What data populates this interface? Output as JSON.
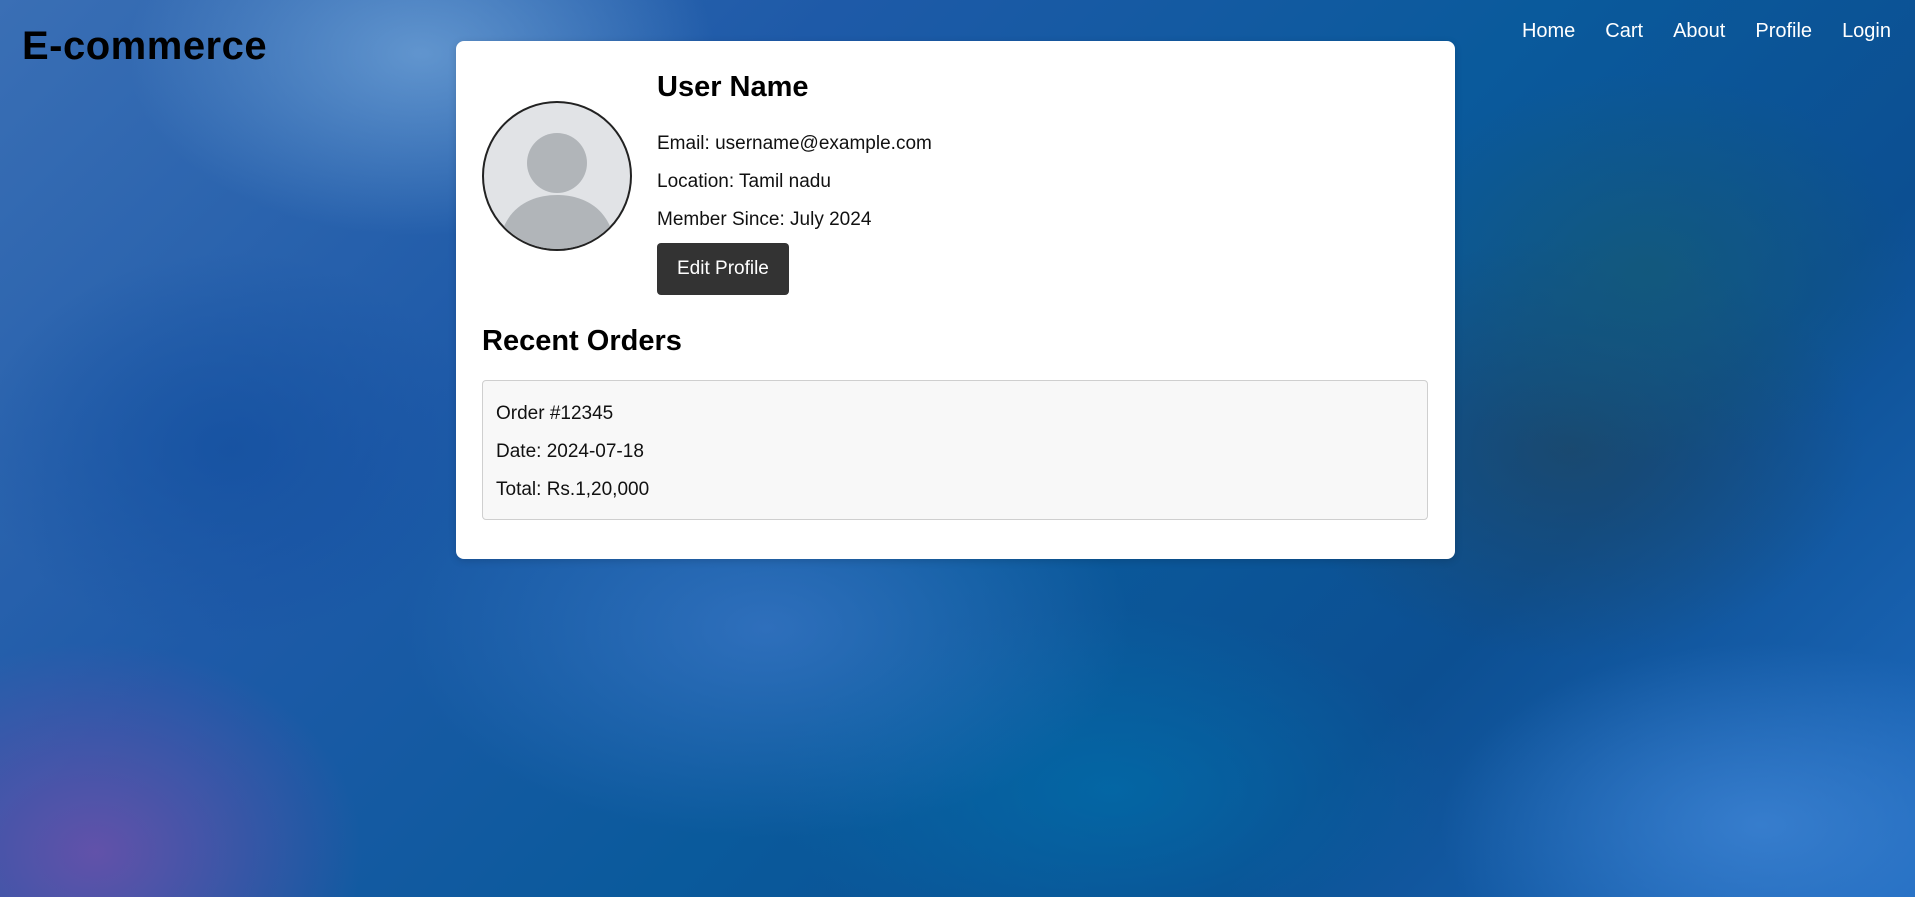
{
  "brand": "E-commerce",
  "nav": [
    {
      "label": "Home",
      "name": "nav-home"
    },
    {
      "label": "Cart",
      "name": "nav-cart"
    },
    {
      "label": "About",
      "name": "nav-about"
    },
    {
      "label": "Profile",
      "name": "nav-profile"
    },
    {
      "label": "Login",
      "name": "nav-login"
    }
  ],
  "profile": {
    "avatar_icon": "user-avatar-placeholder-icon",
    "name": "User Name",
    "email": "Email: username@example.com",
    "location": "Location: Tamil nadu",
    "member_since": "Member Since: July 2024",
    "edit_label": "Edit Profile"
  },
  "orders": {
    "title": "Recent Orders",
    "items": [
      {
        "number": "Order #12345",
        "date": "Date: 2024-07-18",
        "total": "Total: Rs.1,20,000"
      }
    ]
  },
  "colors": {
    "nav_text": "#ffffff",
    "card_bg": "#ffffff",
    "button_bg": "#333333",
    "order_bg": "#f8f8f8",
    "avatar_bg": "#e1e3e6",
    "avatar_fg": "#b1b5b9"
  }
}
